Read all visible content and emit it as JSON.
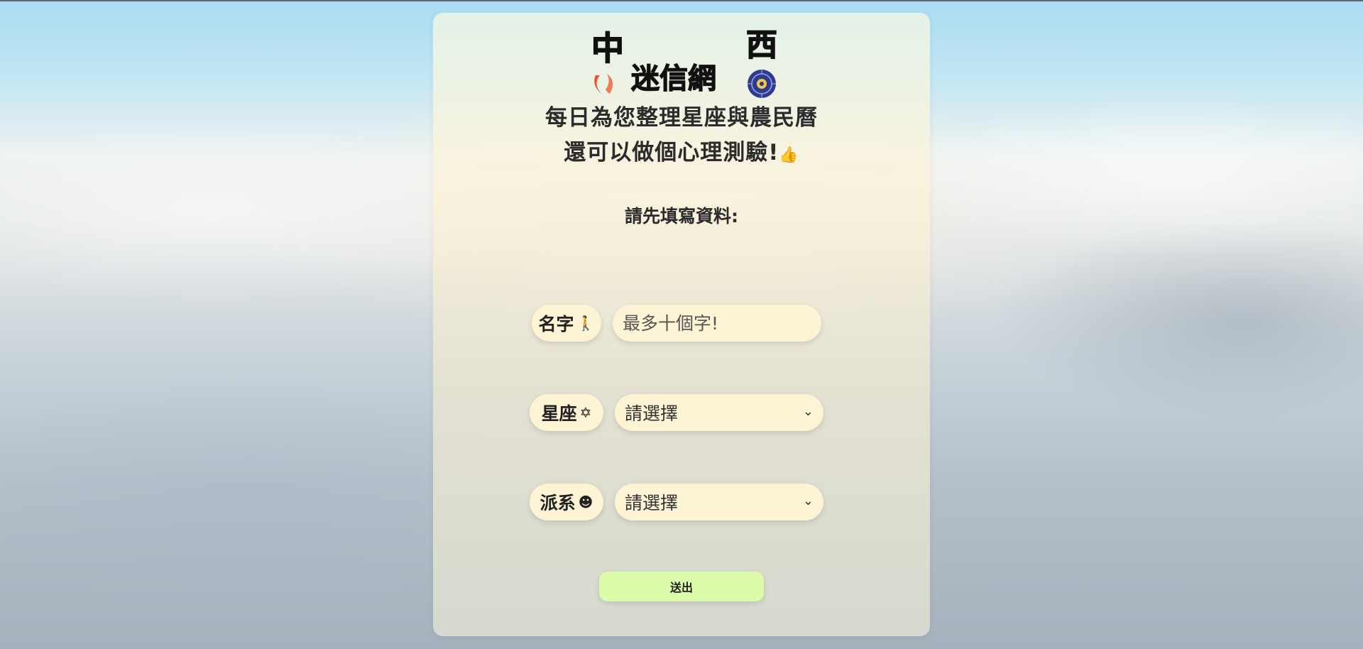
{
  "logo": {
    "char_left": "中",
    "char_right": "西",
    "name": "迷信網"
  },
  "headline": {
    "line1": "每日為您整理星座與農民曆",
    "line2": "還可以做個心理測驗!",
    "line2_icon": "thumbs-up-icon"
  },
  "form": {
    "prompt": "請先填寫資料:",
    "name": {
      "label": "名字",
      "icon": "person-pointing-icon",
      "placeholder": "最多十個字!",
      "value": ""
    },
    "zodiac": {
      "label": "星座",
      "icon": "star-of-david-icon",
      "selected": "請選擇"
    },
    "faction": {
      "label": "派系",
      "icon": "smiley-icon",
      "selected": "請選擇"
    },
    "submit_label": "送出"
  },
  "colors": {
    "pill": "#fcf4d4",
    "submit": "#dcfcaa",
    "logo_red": "#e8523a",
    "logo_blue": "#2e3b8f"
  }
}
